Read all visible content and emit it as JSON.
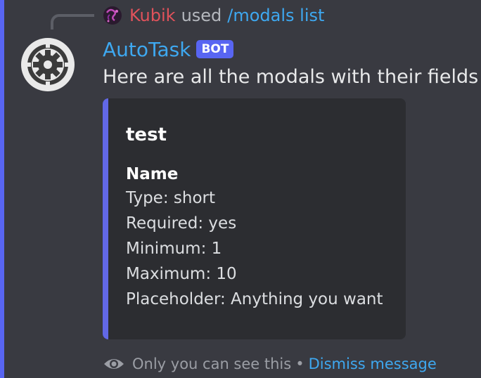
{
  "reply": {
    "avatar_icon": "swirl-avatar-icon",
    "user": "Kubik",
    "verb": "used",
    "command": "/modals list"
  },
  "author": {
    "avatar_icon": "gear-icon",
    "name": "AutoTask",
    "badge": "BOT"
  },
  "message": {
    "content": "Here are all the modals with their fields!"
  },
  "embed": {
    "title": "test",
    "field": {
      "name": "Name",
      "lines": [
        "Type: short",
        "Required: yes",
        "Minimum: 1",
        "Maximum: 10",
        "Placeholder: Anything you want"
      ]
    }
  },
  "footer": {
    "icon": "eye-icon",
    "text": "Only you can see this",
    "separator": "•",
    "dismiss": "Dismiss message"
  },
  "colors": {
    "background": "#393a41",
    "accent": "#5865f2",
    "link": "#3ea8f0",
    "reply_user": "#e0525b",
    "embed_bg": "#2c2d31"
  }
}
